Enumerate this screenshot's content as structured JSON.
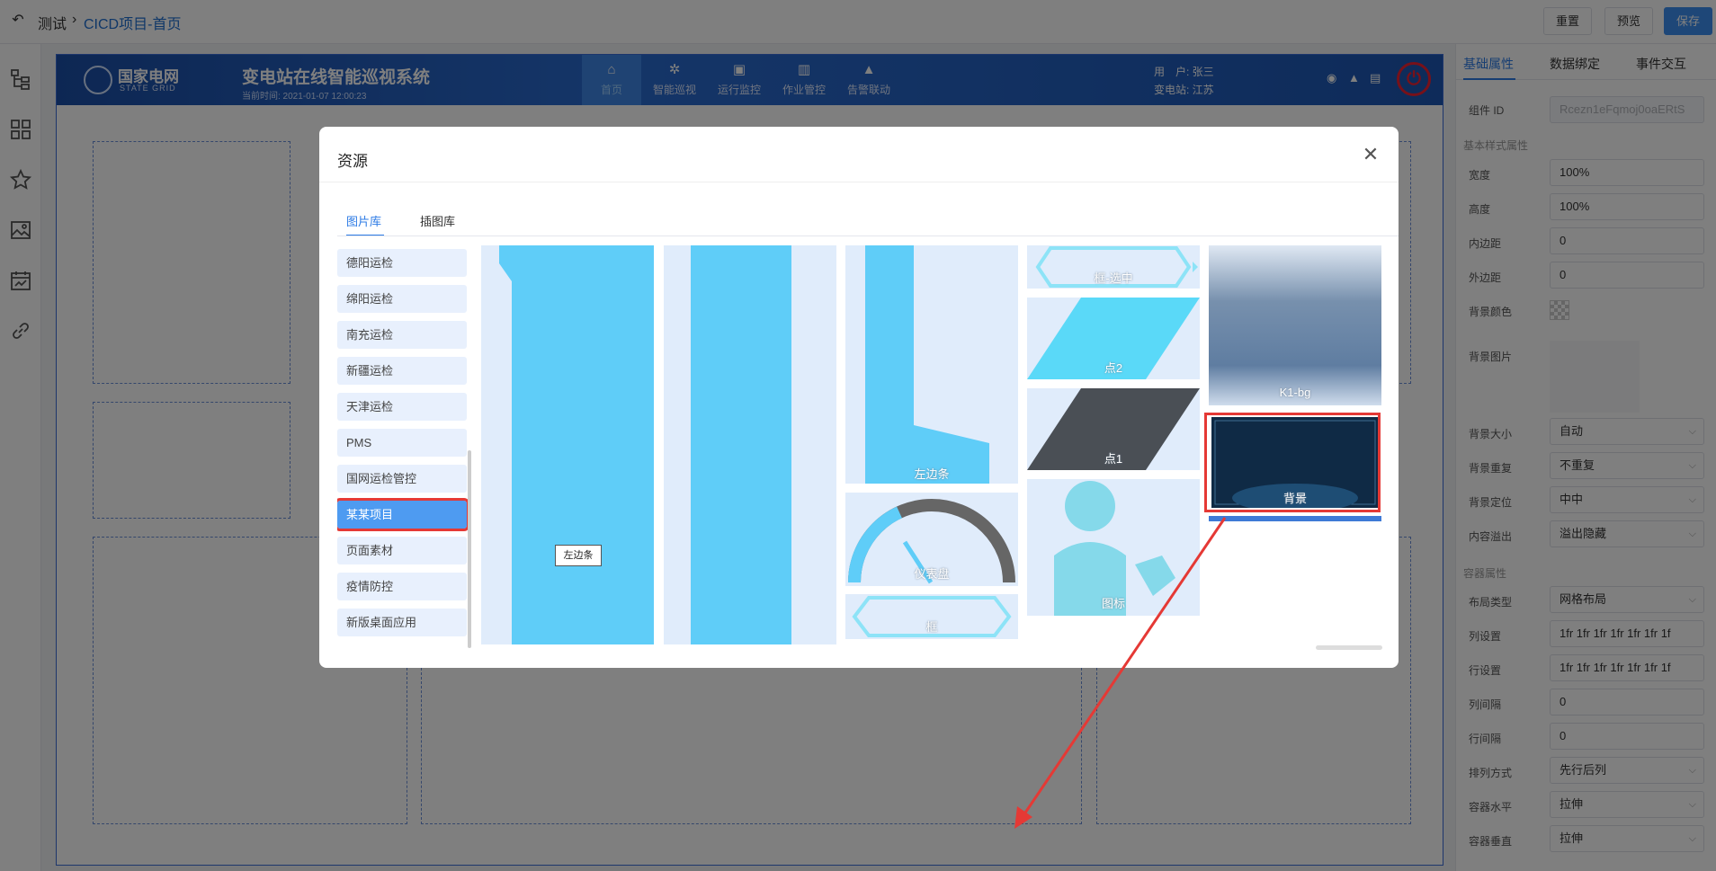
{
  "topbar": {
    "back_icon": "undo-icon",
    "crumb_root": "测试",
    "crumb_sep": "›",
    "crumb_current": "CICD项目-首页",
    "buttons": {
      "reset": "重置",
      "preview": "预览",
      "save": "保存"
    }
  },
  "leftrail": {
    "icons": [
      "tree-icon",
      "grid-icon",
      "star-icon",
      "image-icon",
      "chart-icon",
      "link-icon"
    ]
  },
  "preview_header": {
    "logo_text": "国家电网",
    "logo_sub": "STATE GRID",
    "system_title": "变电站在线智能巡视系统",
    "current_time": "当前时间:  2021-01-07  12:00:23",
    "nav": [
      {
        "label": "首页",
        "icon": "⌂"
      },
      {
        "label": "智能巡视",
        "icon": "✲"
      },
      {
        "label": "运行监控",
        "icon": "▣"
      },
      {
        "label": "作业管控",
        "icon": "▥"
      },
      {
        "label": "告警联动",
        "icon": "▲"
      }
    ],
    "user_label": "用　户: 张三",
    "station_label": "变电站:  江苏",
    "power_icon": "⏻"
  },
  "right_panel": {
    "tabs": [
      "基础属性",
      "数据绑定",
      "事件交互"
    ],
    "component_id_label": "组件 ID",
    "component_id_value": "Rcezn1eFqmoj0oaERtS",
    "basic_style_section": "基本样式属性",
    "width_label": "宽度",
    "width_value": "100%",
    "height_label": "高度",
    "height_value": "100%",
    "padding_label": "内边距",
    "padding_value": "0",
    "margin_label": "外边距",
    "margin_value": "0",
    "bgcolor_label": "背景颜色",
    "bgimage_label": "背景图片",
    "bgsize_label": "背景大小",
    "bgsize_value": "自动",
    "bgrepeat_label": "背景重复",
    "bgrepeat_value": "不重复",
    "bgpos_label": "背景定位",
    "bgpos_value": "中中",
    "overflow_label": "内容溢出",
    "overflow_value": "溢出隐藏",
    "container_section": "容器属性",
    "layout_label": "布局类型",
    "layout_value": "网格布局",
    "cols_label": "列设置",
    "cols_value": "1fr 1fr 1fr 1fr 1fr 1fr 1f",
    "rows_label": "行设置",
    "rows_value": "1fr 1fr 1fr 1fr 1fr 1fr 1f",
    "colgap_label": "列间隔",
    "colgap_value": "0",
    "rowgap_label": "行间隔",
    "rowgap_value": "0",
    "arrange_label": "排列方式",
    "arrange_value": "先行后列",
    "halign_label": "容器水平",
    "halign_value": "拉伸",
    "valign_label": "容器垂直",
    "valign_value": "拉伸"
  },
  "modal": {
    "title": "资源",
    "close_icon": "close-icon",
    "tabs": [
      "图片库",
      "插图库"
    ],
    "categories": [
      "德阳运检",
      "绵阳运检",
      "南充运检",
      "新疆运检",
      "天津运检",
      "PMS",
      "国网运检管控",
      "某某项目",
      "页面素材",
      "疫情防控",
      "新版桌面应用"
    ],
    "selected_category": "某某项目",
    "tiles": {
      "left_bar_label": "左边条",
      "gauge_label": "仪表盘",
      "frame_label": "框",
      "frame_selected_label": "框-选中",
      "dot2_label": "点2",
      "dot1_label": "点1",
      "icon_label": "图标",
      "k1bg_label": "K1-bg",
      "background_label": "背景"
    },
    "tooltip": "左边条"
  },
  "colors": {
    "accent": "#2d7be5",
    "highlight_red": "#e53935",
    "tile_bg": "#e0ecfb",
    "bar_blue": "#5fcdf8"
  }
}
